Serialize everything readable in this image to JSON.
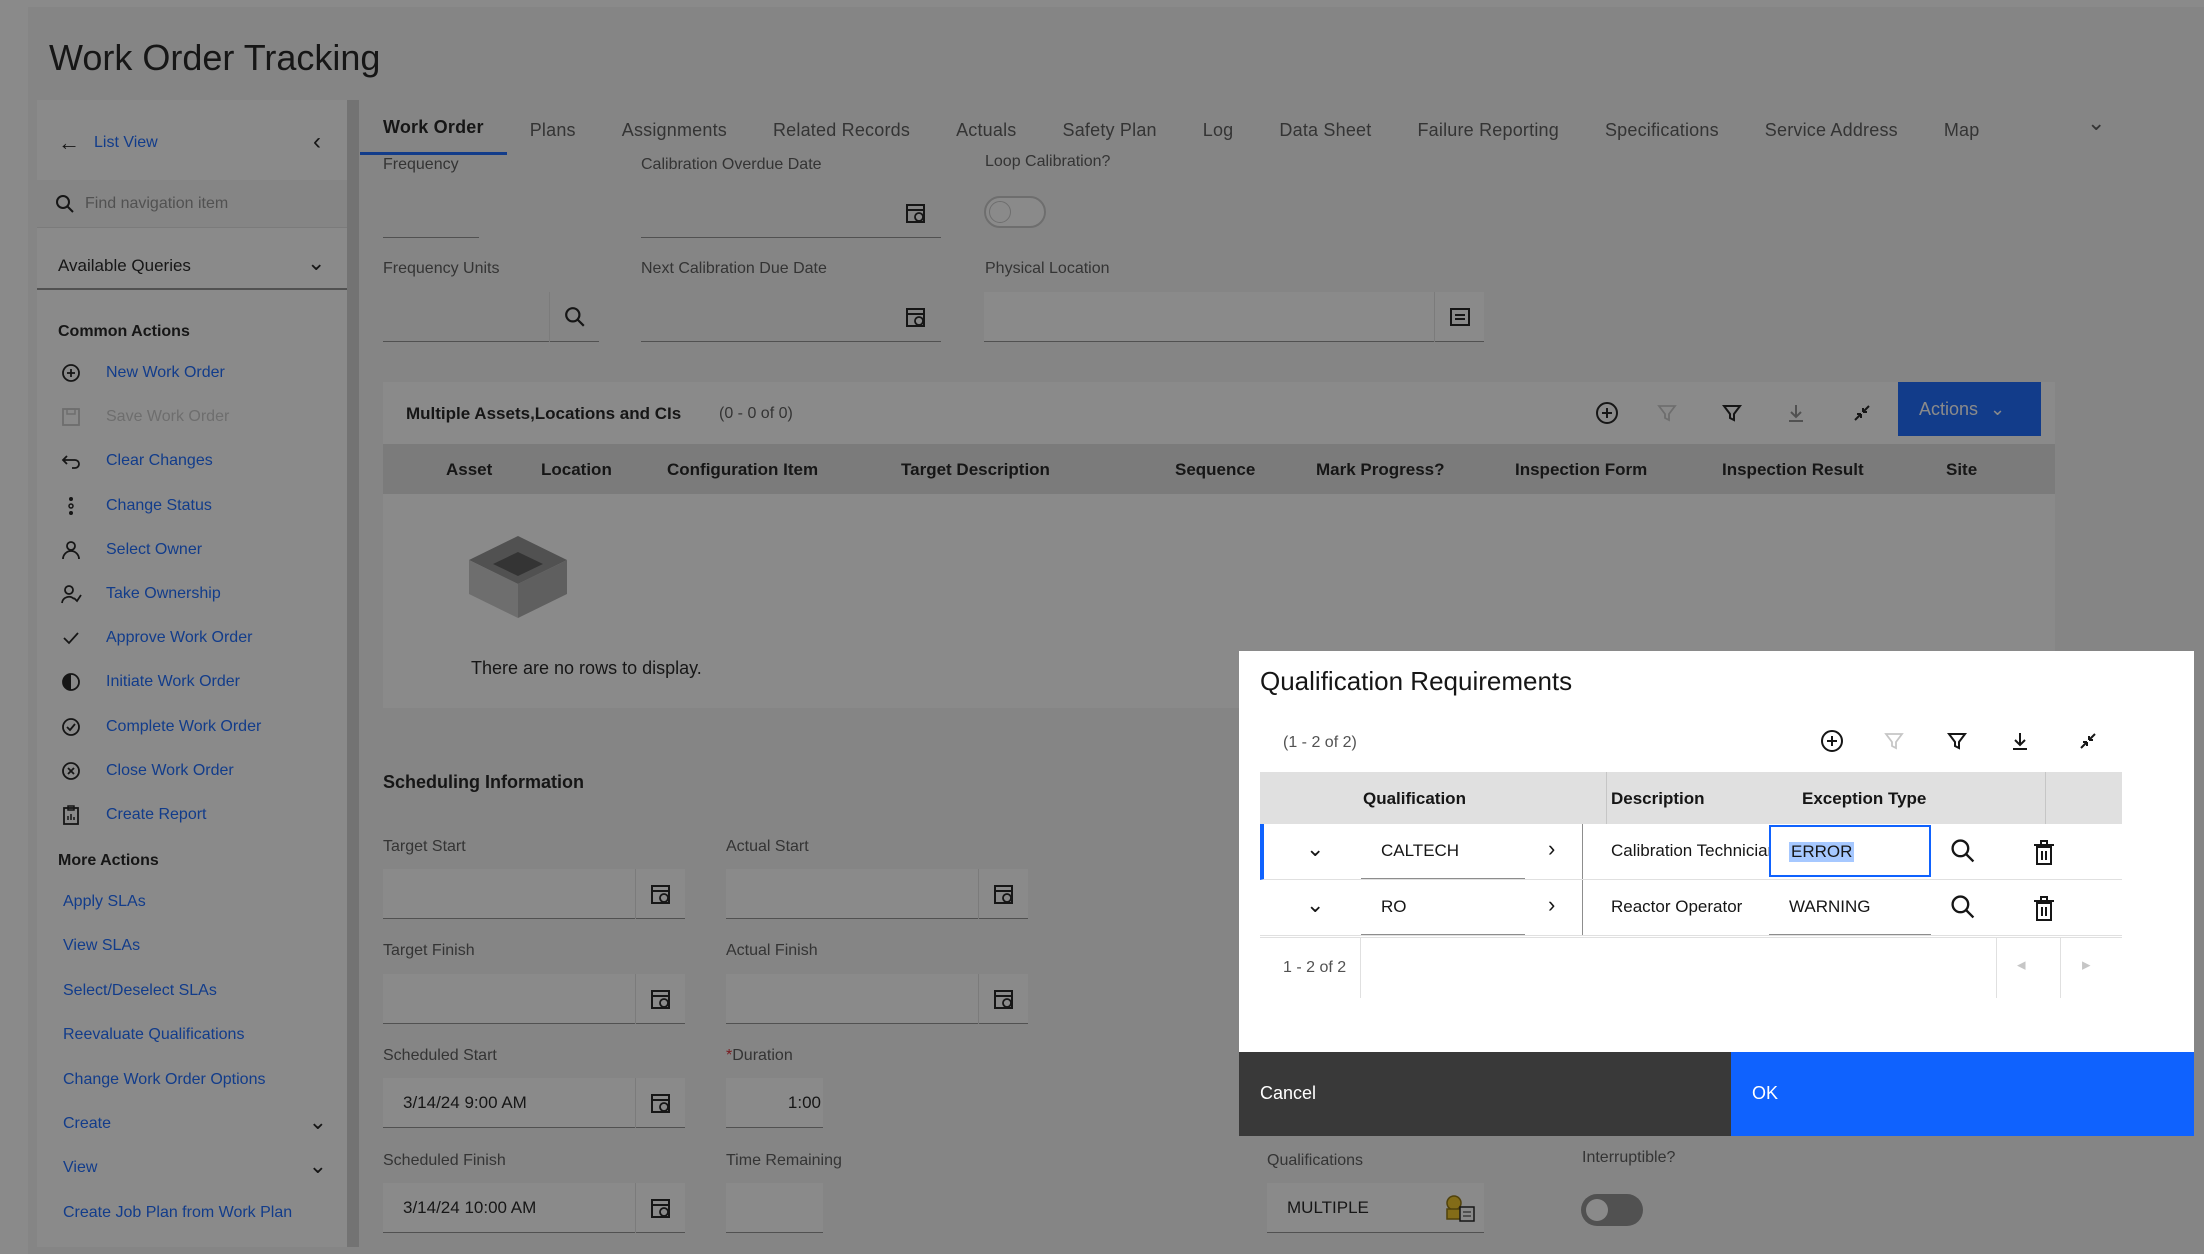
{
  "app": {
    "title": "Work Order Tracking"
  },
  "nav": {
    "list_view": "List View",
    "search_placeholder": "Find navigation item",
    "queries": "Available Queries",
    "common_actions": "Common Actions",
    "common_items": [
      {
        "label": "New Work Order",
        "icon": "add-circle-icon",
        "disabled": false
      },
      {
        "label": "Save Work Order",
        "icon": "save-icon",
        "disabled": true
      },
      {
        "label": "Clear Changes",
        "icon": "undo-icon",
        "disabled": false
      },
      {
        "label": "Change Status",
        "icon": "status-icon",
        "disabled": false
      },
      {
        "label": "Select Owner",
        "icon": "user-icon",
        "disabled": false
      },
      {
        "label": "Take Ownership",
        "icon": "user-check-icon",
        "disabled": false
      },
      {
        "label": "Approve Work Order",
        "icon": "checkmark-icon",
        "disabled": false
      },
      {
        "label": "Initiate Work Order",
        "icon": "progress-icon",
        "disabled": false
      },
      {
        "label": "Complete Work Order",
        "icon": "checkmark-circle-icon",
        "disabled": false
      },
      {
        "label": "Close Work Order",
        "icon": "close-circle-icon",
        "disabled": false
      },
      {
        "label": "Create Report",
        "icon": "report-icon",
        "disabled": false
      }
    ],
    "more_actions": "More Actions",
    "more_items": [
      {
        "label": "Apply SLAs",
        "expand": false
      },
      {
        "label": "View SLAs",
        "expand": false
      },
      {
        "label": "Select/Deselect SLAs",
        "expand": false
      },
      {
        "label": "Reevaluate Qualifications",
        "expand": false
      },
      {
        "label": "Change Work Order Options",
        "expand": false
      },
      {
        "label": "Create",
        "expand": true
      },
      {
        "label": "View",
        "expand": true
      },
      {
        "label": "Create Job Plan from Work Plan",
        "expand": false
      }
    ]
  },
  "tabs": [
    "Work Order",
    "Plans",
    "Assignments",
    "Related Records",
    "Actuals",
    "Safety Plan",
    "Log",
    "Data Sheet",
    "Failure Reporting",
    "Specifications",
    "Service Address",
    "Map"
  ],
  "fields": {
    "frequency": "Frequency",
    "calibration_overdue": "Calibration Overdue Date",
    "loop_calibration": "Loop Calibration?",
    "frequency_units": "Frequency Units",
    "next_calibration": "Next Calibration Due Date",
    "physical_location": "Physical Location"
  },
  "assets_table": {
    "title": "Multiple Assets,Locations and CIs",
    "count": "(0 - 0 of 0)",
    "actions": "Actions",
    "columns": [
      "Asset",
      "Location",
      "Configuration Item",
      "Target Description",
      "Sequence",
      "Mark Progress?",
      "Inspection Form",
      "Inspection Result",
      "Site"
    ],
    "empty": "There are no rows to display."
  },
  "scheduling": {
    "title": "Scheduling Information",
    "target_start": "Target Start",
    "actual_start": "Actual Start",
    "target_finish": "Target Finish",
    "actual_finish": "Actual Finish",
    "scheduled_start": "Scheduled Start",
    "scheduled_start_value": "3/14/24 9:00 AM",
    "duration_req": "*",
    "duration": "Duration",
    "duration_value": "1:00",
    "scheduled_finish": "Scheduled Finish",
    "scheduled_finish_value": "3/14/24 10:00 AM",
    "time_remaining": "Time Remaining",
    "qualifications": "Qualifications",
    "qualifications_value": "MULTIPLE",
    "interruptible": "Interruptible?"
  },
  "dialog": {
    "title": "Qualification Requirements",
    "count": "(1 - 2 of 2)",
    "columns": [
      "Qualification",
      "Description",
      "Exception Type"
    ],
    "rows": [
      {
        "qualification": "CALTECH",
        "description": "Calibration Technician",
        "exception": "ERROR"
      },
      {
        "qualification": "RO",
        "description": "Reactor Operator",
        "exception": "WARNING"
      }
    ],
    "pagination": "1 - 2 of 2",
    "cancel": "Cancel",
    "ok": "OK"
  },
  "colors": {
    "accent": "#0f62fe",
    "overlay": "rgba(22,22,22,0.5)"
  }
}
